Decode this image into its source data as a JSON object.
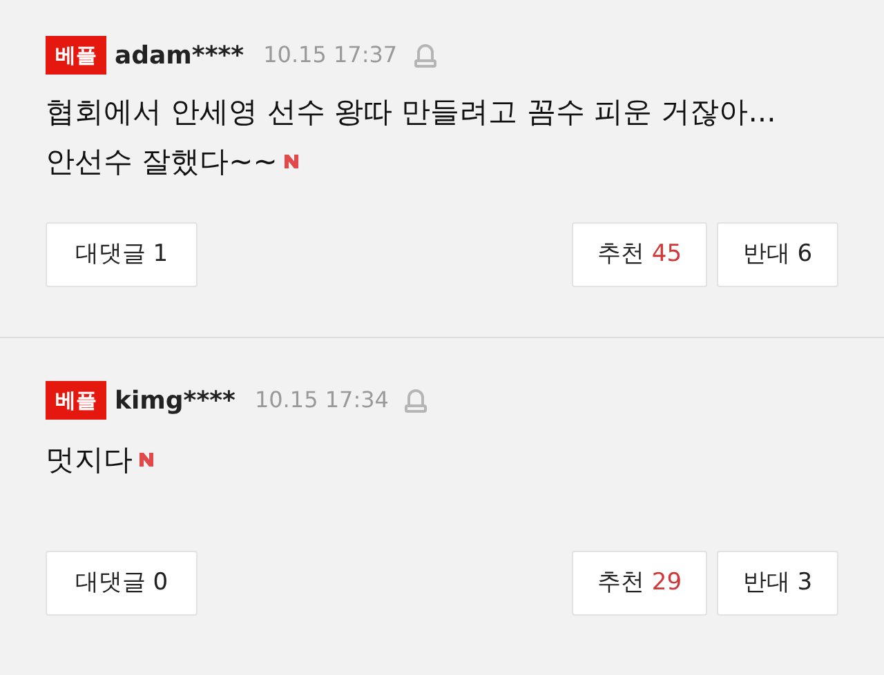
{
  "comments": [
    {
      "badge": "베플",
      "user": "adam****",
      "time": "10.15 17:37",
      "lines": [
        "협회에서 안세영 선수 왕따 만들려고 꼼수 피운 거잖아...",
        "안선수 잘했다~~"
      ],
      "reply_label": "대댓글",
      "reply_count": "1",
      "like_label": "추천",
      "like_count": "45",
      "dislike_label": "반대",
      "dislike_count": "6"
    },
    {
      "badge": "베플",
      "user": "kimg****",
      "time": "10.15 17:34",
      "lines": [
        "멋지다"
      ],
      "reply_label": "대댓글",
      "reply_count": "0",
      "like_label": "추천",
      "like_count": "29",
      "dislike_label": "반대",
      "dislike_count": "3"
    }
  ]
}
